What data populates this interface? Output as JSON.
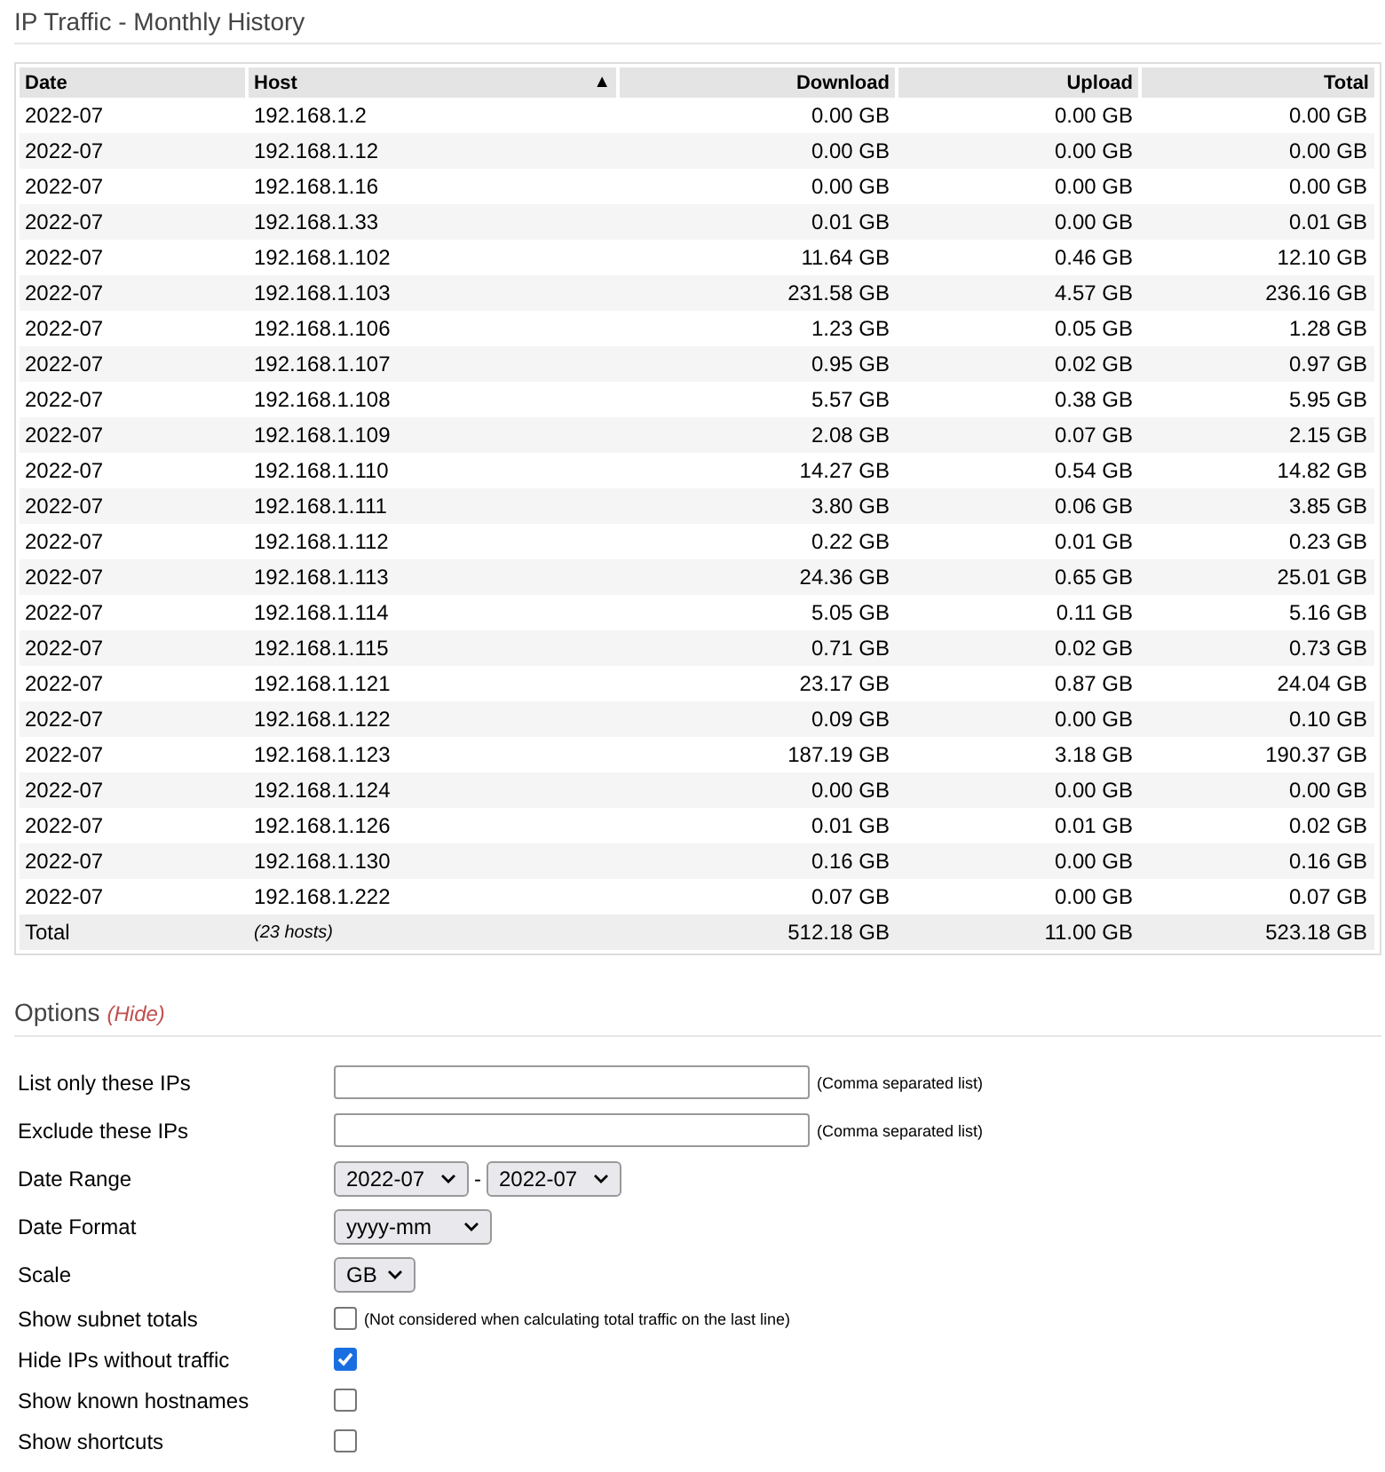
{
  "title": "IP Traffic - Monthly History",
  "table": {
    "columns": [
      {
        "label": "Date"
      },
      {
        "label": "Host",
        "sort_indicator": "▲"
      },
      {
        "label": "Download"
      },
      {
        "label": "Upload"
      },
      {
        "label": "Total"
      }
    ],
    "rows": [
      [
        "2022-07",
        "192.168.1.2",
        "0.00 GB",
        "0.00 GB",
        "0.00 GB"
      ],
      [
        "2022-07",
        "192.168.1.12",
        "0.00 GB",
        "0.00 GB",
        "0.00 GB"
      ],
      [
        "2022-07",
        "192.168.1.16",
        "0.00 GB",
        "0.00 GB",
        "0.00 GB"
      ],
      [
        "2022-07",
        "192.168.1.33",
        "0.01 GB",
        "0.00 GB",
        "0.01 GB"
      ],
      [
        "2022-07",
        "192.168.1.102",
        "11.64 GB",
        "0.46 GB",
        "12.10 GB"
      ],
      [
        "2022-07",
        "192.168.1.103",
        "231.58 GB",
        "4.57 GB",
        "236.16 GB"
      ],
      [
        "2022-07",
        "192.168.1.106",
        "1.23 GB",
        "0.05 GB",
        "1.28 GB"
      ],
      [
        "2022-07",
        "192.168.1.107",
        "0.95 GB",
        "0.02 GB",
        "0.97 GB"
      ],
      [
        "2022-07",
        "192.168.1.108",
        "5.57 GB",
        "0.38 GB",
        "5.95 GB"
      ],
      [
        "2022-07",
        "192.168.1.109",
        "2.08 GB",
        "0.07 GB",
        "2.15 GB"
      ],
      [
        "2022-07",
        "192.168.1.110",
        "14.27 GB",
        "0.54 GB",
        "14.82 GB"
      ],
      [
        "2022-07",
        "192.168.1.111",
        "3.80 GB",
        "0.06 GB",
        "3.85 GB"
      ],
      [
        "2022-07",
        "192.168.1.112",
        "0.22 GB",
        "0.01 GB",
        "0.23 GB"
      ],
      [
        "2022-07",
        "192.168.1.113",
        "24.36 GB",
        "0.65 GB",
        "25.01 GB"
      ],
      [
        "2022-07",
        "192.168.1.114",
        "5.05 GB",
        "0.11 GB",
        "5.16 GB"
      ],
      [
        "2022-07",
        "192.168.1.115",
        "0.71 GB",
        "0.02 GB",
        "0.73 GB"
      ],
      [
        "2022-07",
        "192.168.1.121",
        "23.17 GB",
        "0.87 GB",
        "24.04 GB"
      ],
      [
        "2022-07",
        "192.168.1.122",
        "0.09 GB",
        "0.00 GB",
        "0.10 GB"
      ],
      [
        "2022-07",
        "192.168.1.123",
        "187.19 GB",
        "3.18 GB",
        "190.37 GB"
      ],
      [
        "2022-07",
        "192.168.1.124",
        "0.00 GB",
        "0.00 GB",
        "0.00 GB"
      ],
      [
        "2022-07",
        "192.168.1.126",
        "0.01 GB",
        "0.01 GB",
        "0.02 GB"
      ],
      [
        "2022-07",
        "192.168.1.130",
        "0.16 GB",
        "0.00 GB",
        "0.16 GB"
      ],
      [
        "2022-07",
        "192.168.1.222",
        "0.07 GB",
        "0.00 GB",
        "0.07 GB"
      ]
    ],
    "total": {
      "label": "Total",
      "hosts": "(23 hosts)",
      "download": "512.18 GB",
      "upload": "11.00 GB",
      "total": "523.18 GB"
    }
  },
  "options": {
    "title": "Options",
    "toggle": "(Hide)",
    "items": [
      {
        "kind": "text",
        "label": "List only these IPs",
        "note": "(Comma separated list)"
      },
      {
        "kind": "text",
        "label": "Exclude these IPs",
        "note": "(Comma separated list)"
      },
      {
        "kind": "range",
        "label": "Date Range",
        "from": "2022-07",
        "separator": "-",
        "to": "2022-07"
      },
      {
        "kind": "select",
        "label": "Date Format",
        "value": "yyyy-mm"
      },
      {
        "kind": "select",
        "label": "Scale",
        "value": "GB"
      },
      {
        "kind": "checkbox",
        "label": "Show subnet totals",
        "checked": false,
        "note": "(Not considered when calculating total traffic on the last line)"
      },
      {
        "kind": "checkbox",
        "label": "Hide IPs without traffic",
        "checked": true
      },
      {
        "kind": "checkbox",
        "label": "Show known hostnames",
        "checked": false
      },
      {
        "kind": "checkbox",
        "label": "Show shortcuts",
        "checked": false
      }
    ]
  }
}
